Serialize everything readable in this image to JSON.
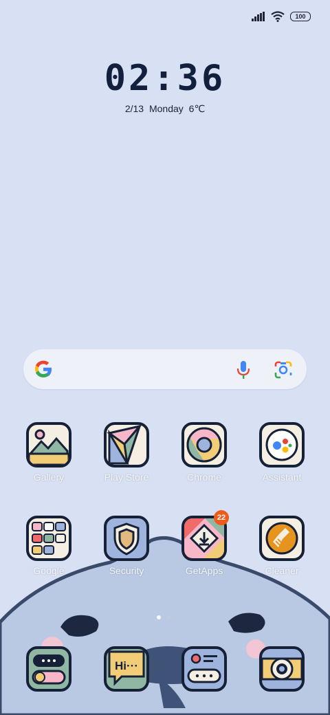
{
  "status": {
    "battery": "100"
  },
  "clock": {
    "time": "02:36",
    "date": "2/13  Monday  6℃"
  },
  "apps_row1": [
    {
      "label": "Gallery",
      "icon": "gallery-icon"
    },
    {
      "label": "Play Store",
      "icon": "play-store-icon"
    },
    {
      "label": "Chrome",
      "icon": "chrome-icon"
    },
    {
      "label": "Assistant",
      "icon": "assistant-icon"
    }
  ],
  "apps_row2": [
    {
      "label": "Google",
      "icon": "google-folder-icon"
    },
    {
      "label": "Security",
      "icon": "security-icon"
    },
    {
      "label": "GetApps",
      "icon": "getapps-icon",
      "badge": "22"
    },
    {
      "label": "Cleaner",
      "icon": "cleaner-icon"
    }
  ],
  "dock": [
    {
      "icon": "phone-icon"
    },
    {
      "icon": "messages-icon",
      "text": "Hi···"
    },
    {
      "icon": "contacts-icon"
    },
    {
      "icon": "camera-icon"
    }
  ],
  "colors": {
    "background": "#d7e1f3",
    "outline": "#162036",
    "badge": "#f05a1a"
  }
}
